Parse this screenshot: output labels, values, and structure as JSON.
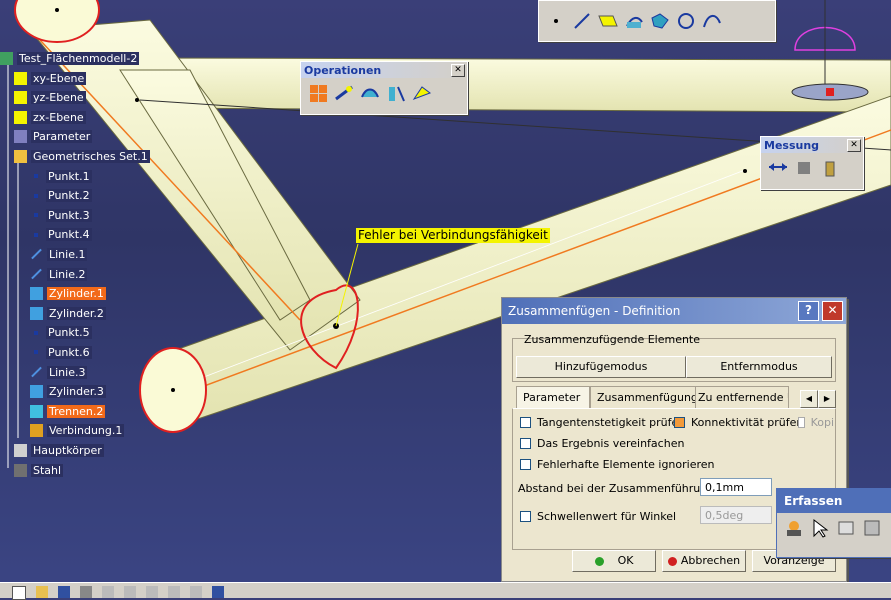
{
  "tree": {
    "root": "Test_Flächenmodell-2",
    "items": [
      {
        "label": "xy-Ebene",
        "icon": "plane-icon"
      },
      {
        "label": "yz-Ebene",
        "icon": "plane-icon"
      },
      {
        "label": "zx-Ebene",
        "icon": "plane-icon"
      },
      {
        "label": "Parameter",
        "icon": "parameter-icon"
      },
      {
        "label": "Geometrisches Set.1",
        "icon": "geometric-set-icon"
      },
      {
        "label": "Punkt.1",
        "icon": "point-icon"
      },
      {
        "label": "Punkt.2",
        "icon": "point-icon"
      },
      {
        "label": "Punkt.3",
        "icon": "point-icon"
      },
      {
        "label": "Punkt.4",
        "icon": "point-icon"
      },
      {
        "label": "Linie.1",
        "icon": "line-icon"
      },
      {
        "label": "Linie.2",
        "icon": "line-icon"
      },
      {
        "label": "Zylinder.1",
        "icon": "cylinder-icon",
        "highlighted": true
      },
      {
        "label": "Zylinder.2",
        "icon": "cylinder-icon"
      },
      {
        "label": "Punkt.5",
        "icon": "point-icon"
      },
      {
        "label": "Punkt.6",
        "icon": "point-icon"
      },
      {
        "label": "Linie.3",
        "icon": "line-icon"
      },
      {
        "label": "Zylinder.3",
        "icon": "cylinder-icon"
      },
      {
        "label": "Trennen.2",
        "icon": "split-icon",
        "highlighted": true
      },
      {
        "label": "Verbindung.1",
        "icon": "join-icon"
      },
      {
        "label": "Hauptkörper",
        "icon": "body-icon"
      },
      {
        "label": "Stahl",
        "icon": "material-icon"
      }
    ]
  },
  "palettes": {
    "operationen": {
      "title": "Operationen",
      "icons": [
        "join-icon",
        "healing-icon",
        "untrim-icon",
        "extract-icon",
        "transform-icon"
      ]
    },
    "messung": {
      "title": "Messung",
      "icons": [
        "measure-between-icon",
        "measure-item-icon",
        "measure-inertia-icon"
      ]
    },
    "erfassen": {
      "title": "Erfassen",
      "icons": [
        "capture-icon",
        "select-icon",
        "capture-settings-icon",
        "album-icon"
      ]
    }
  },
  "annotation": "Fehler bei Verbindungsfähigkeit",
  "dialog": {
    "title": "Zusammenfügen - Definition",
    "group_label": "Zusammenzufügende Elemente",
    "add_mode": "Hinzufügemodus",
    "remove_mode": "Entfernmodus",
    "tabs": [
      "Parameter",
      "Zusammenfügung",
      "Zu entfernende Un"
    ],
    "checks": {
      "tangent": "Tangentenstetigkeit prüfen",
      "connectivity": "Konnektivität prüfen",
      "copy": "Kopi",
      "simplify": "Das Ergebnis vereinfachen",
      "ignore": "Fehlerhafte Elemente ignorieren",
      "threshold": "Schwellenwert für Winkel"
    },
    "distance_label": "Abstand bei der Zusammenführung",
    "distance_value": "0,1mm",
    "angle_value": "0,5deg",
    "ok": "OK",
    "cancel": "Abbrechen",
    "preview": "Voranzeige"
  },
  "colors": {
    "highlight": "#f26a1a",
    "cylinder": "#f3f3c4",
    "edge": "#e02020",
    "annotation_bg": "#f4f400"
  }
}
